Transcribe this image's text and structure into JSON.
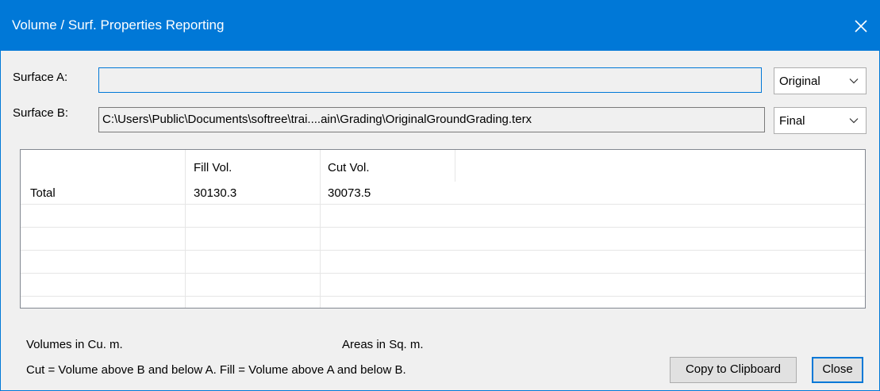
{
  "window": {
    "title": "Volume / Surf. Properties Reporting"
  },
  "surface_a": {
    "label": "Surface A:",
    "path": "",
    "combo_value": "Original"
  },
  "surface_b": {
    "label": "Surface B:",
    "path": "C:\\Users\\Public\\Documents\\softree\\trai....ain\\Grading\\OriginalGroundGrading.terx",
    "combo_value": "Final"
  },
  "table": {
    "columns": [
      "",
      "Fill Vol.",
      "Cut Vol.",
      ""
    ],
    "rows": [
      [
        "Total",
        "30130.3",
        "30073.5",
        ""
      ]
    ]
  },
  "footer": {
    "volumes_units": "Volumes in Cu. m.",
    "areas_units": "Areas in Sq. m.",
    "definition": "Cut = Volume above B and below A.  Fill = Volume above A and below B."
  },
  "buttons": {
    "copy_label": "Copy to Clipboard",
    "close_label": "Close"
  },
  "icons": {
    "close": "close-icon",
    "dropdown": "chevron-down-icon"
  },
  "colors": {
    "titlebar": "#0078d7",
    "dialog_bg": "#f0f0f0",
    "focus_border": "#0078d7"
  }
}
